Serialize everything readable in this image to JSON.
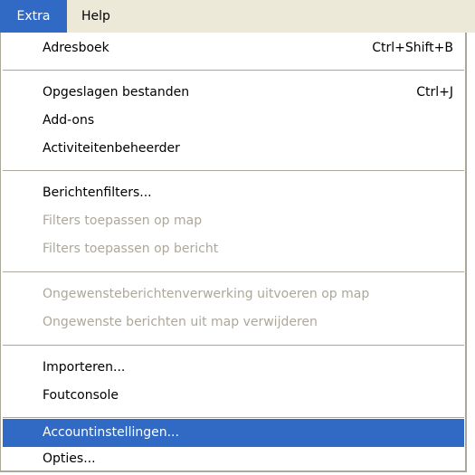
{
  "menubar": {
    "items": [
      {
        "label": "Extra",
        "active": true
      },
      {
        "label": "Help",
        "active": false
      }
    ]
  },
  "colors": {
    "highlight": "#316ac5",
    "disabled_text": "#aca899",
    "menubar_bg": "#ece9d8"
  },
  "menu": {
    "items": [
      {
        "label": "Adresboek",
        "shortcut": "Ctrl+Shift+B",
        "enabled": true
      },
      {
        "label": "Opgeslagen bestanden",
        "shortcut": "Ctrl+J",
        "enabled": true
      },
      {
        "label": "Add-ons",
        "enabled": true
      },
      {
        "label": "Activiteitenbeheerder",
        "enabled": true
      },
      {
        "label": "Berichtenfilters...",
        "enabled": true
      },
      {
        "label": "Filters toepassen op map",
        "enabled": false
      },
      {
        "label": "Filters toepassen op bericht",
        "enabled": false
      },
      {
        "label": "Ongewensteberichtenverwerking uitvoeren op map",
        "enabled": false
      },
      {
        "label": "Ongewenste berichten uit map verwijderen",
        "enabled": false
      },
      {
        "label": "Importeren...",
        "enabled": true
      },
      {
        "label": "Foutconsole",
        "enabled": true
      },
      {
        "label": "Accountinstellingen...",
        "enabled": true,
        "selected": true
      },
      {
        "label": "Opties...",
        "enabled": true
      }
    ]
  }
}
